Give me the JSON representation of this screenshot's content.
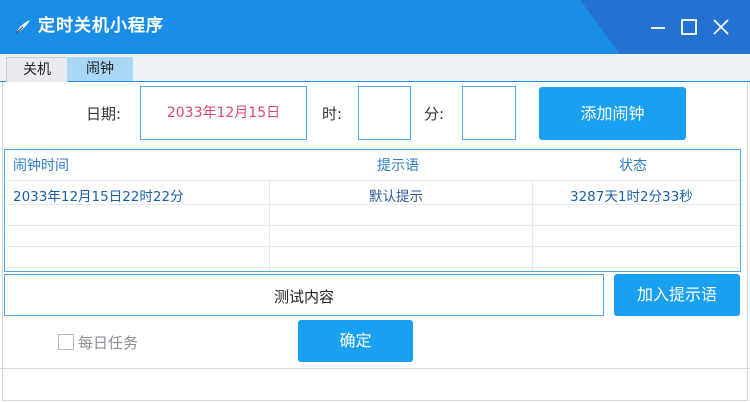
{
  "window": {
    "title": "定时关机小程序",
    "app_icon": "feather-icon",
    "controls": [
      "minimize-icon",
      "maximize-icon",
      "close-icon"
    ]
  },
  "tabs": [
    {
      "label": "关机",
      "active": false
    },
    {
      "label": "闹钟",
      "active": true
    }
  ],
  "form": {
    "date_label": "日期:",
    "date_value": "2033年12月15日",
    "hour_label": "时:",
    "hour_value": "",
    "minute_label": "分:",
    "minute_value": "",
    "add_alarm_button": "添加闹钟"
  },
  "table": {
    "columns": [
      "闹钟时间",
      "提示语",
      "状态"
    ],
    "rows": [
      {
        "time": "2033年12月15日22时22分",
        "message": "默认提示",
        "status": "3287天1时2分33秒"
      }
    ]
  },
  "message": {
    "value": "测试内容",
    "add_button": "加入提示语"
  },
  "daily_task": {
    "label": "每日任务",
    "checked": false
  },
  "confirm_button": "确定",
  "colors": {
    "titlebar": "#1a8ee6",
    "accent_button": "#1aa0f0",
    "date_text": "#d9486e",
    "grid_text": "#1a5faa"
  }
}
